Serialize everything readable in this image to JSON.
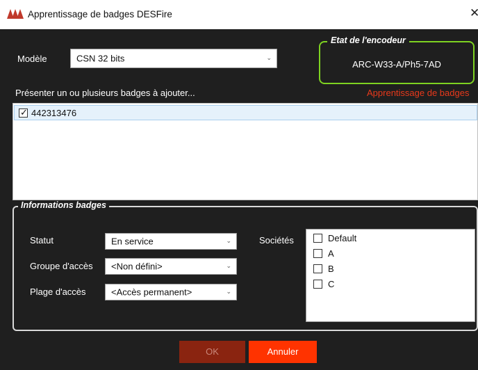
{
  "window": {
    "title": "Apprentissage de badges DESFire",
    "close_glyph": "✕"
  },
  "modele": {
    "label": "Modèle",
    "value": "CSN 32 bits"
  },
  "encoder": {
    "legend": "Etat de l'encodeur",
    "value": "ARC-W33-A/Ph5-7AD",
    "border_color": "#7ed321"
  },
  "badges": {
    "prompt": "Présenter un ou plusieurs badges à ajouter...",
    "status_text": "Apprentissage de badges",
    "status_color": "#e8391b",
    "items": [
      {
        "id": "442313476",
        "checked": true
      }
    ]
  },
  "info": {
    "legend": "Informations badges",
    "statut": {
      "label": "Statut",
      "value": "En service"
    },
    "groupe": {
      "label": "Groupe d'accès",
      "value": "<Non défini>"
    },
    "plage": {
      "label": "Plage d'accès",
      "value": "<Accès permanent>"
    },
    "societes": {
      "label": "Sociétés",
      "items": [
        {
          "name": "Default",
          "checked": false
        },
        {
          "name": "A",
          "checked": false
        },
        {
          "name": "B",
          "checked": false
        },
        {
          "name": "C",
          "checked": false
        }
      ]
    }
  },
  "buttons": {
    "ok": "OK",
    "cancel": "Annuler",
    "accent_color": "#ff3300"
  }
}
